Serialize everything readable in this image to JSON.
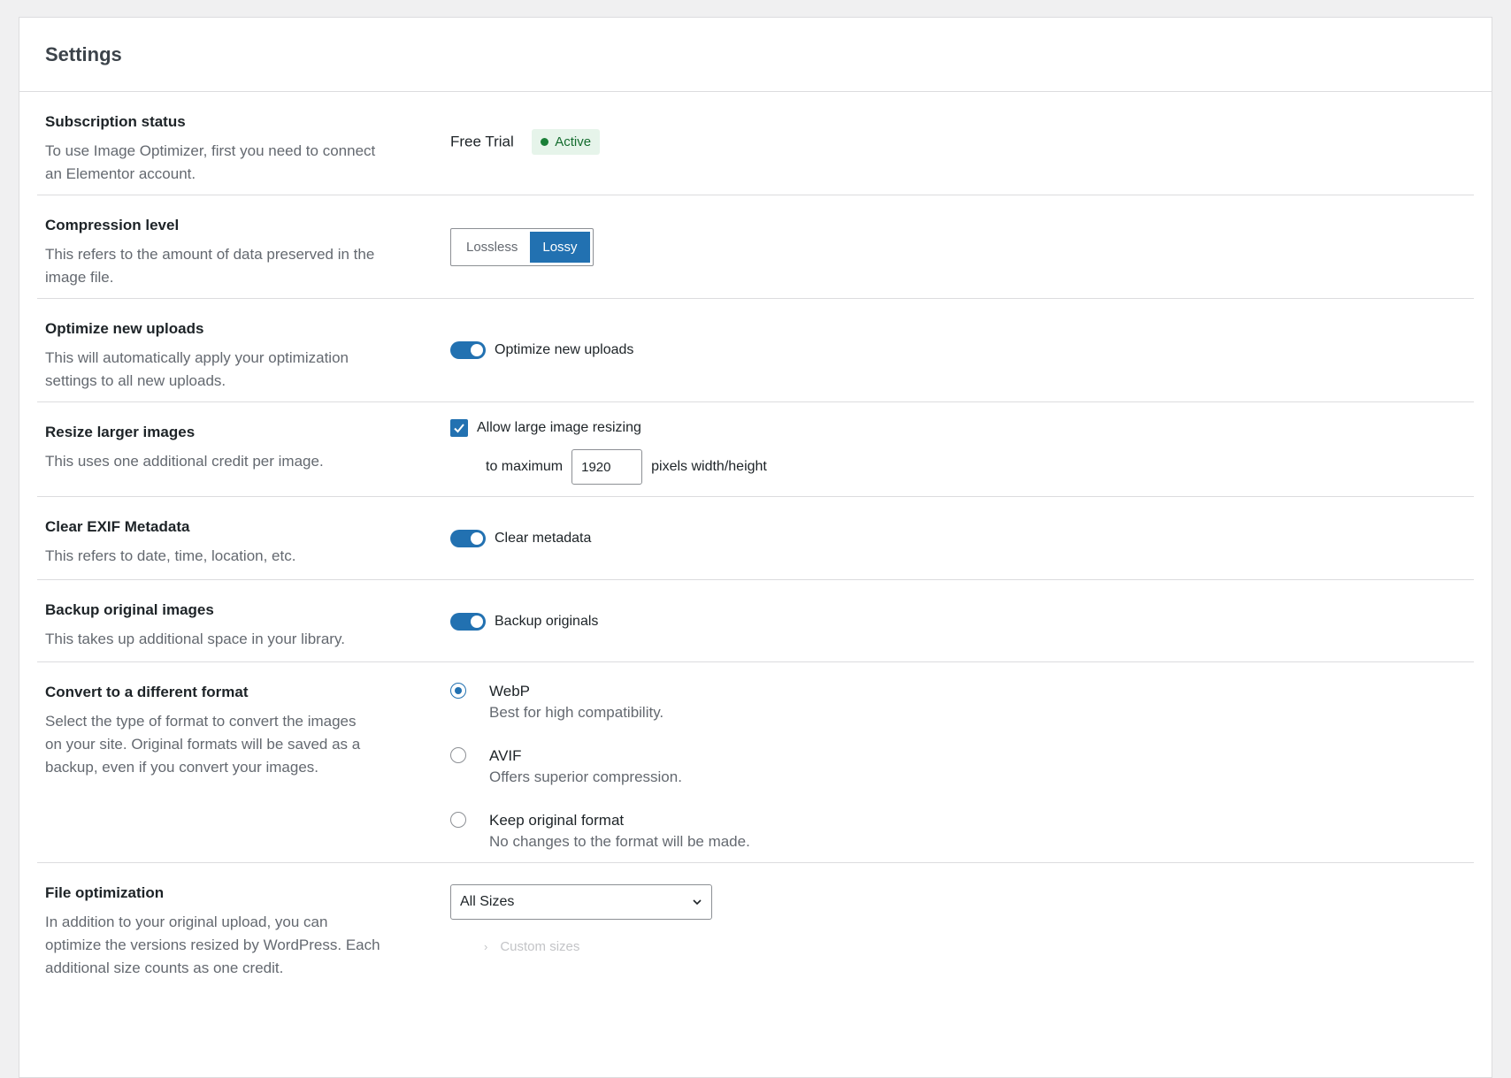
{
  "header": {
    "title": "Settings"
  },
  "subscription": {
    "title": "Subscription status",
    "desc": "To use Image Optimizer, first you need to connect an Elementor account.",
    "plan": "Free Trial",
    "status": "Active",
    "status_color": "#1a7f37"
  },
  "compression": {
    "title": "Compression level",
    "desc": "This refers to the amount of data preserved in the image file.",
    "options": [
      "Lossless",
      "Lossy"
    ],
    "selected": "Lossy"
  },
  "optimize_uploads": {
    "title": "Optimize new uploads",
    "desc": "This will automatically apply your optimization settings to all new uploads.",
    "toggle_label": "Optimize new uploads",
    "enabled": true
  },
  "resize": {
    "title": "Resize larger images",
    "desc": "This uses one additional credit per image.",
    "checkbox_label": "Allow large image resizing",
    "checked": true,
    "prefix": "to maximum",
    "value": "1920",
    "suffix": "pixels width/height"
  },
  "exif": {
    "title": "Clear EXIF Metadata",
    "desc": "This refers to date, time, location, etc.",
    "toggle_label": "Clear metadata",
    "enabled": true
  },
  "backup": {
    "title": "Backup original images",
    "desc": "This takes up additional space in your library.",
    "toggle_label": "Backup originals",
    "enabled": true
  },
  "convert": {
    "title": "Convert to a different format",
    "desc": "Select the type of format to convert the images on your site. Original formats will be saved as a backup, even if you convert your images.",
    "options": [
      {
        "label": "WebP",
        "desc": "Best for high compatibility.",
        "checked": true
      },
      {
        "label": "AVIF",
        "desc": "Offers superior compression.",
        "checked": false
      },
      {
        "label": "Keep original format",
        "desc": "No changes to the format will be made.",
        "checked": false
      }
    ]
  },
  "file_opt": {
    "title": "File optimization",
    "desc": "In addition to your original upload, you can optimize the versions resized by WordPress. Each additional size counts as one credit.",
    "select_value": "All Sizes",
    "custom_sizes": "Custom sizes"
  },
  "colors": {
    "accent": "#2271b1"
  }
}
